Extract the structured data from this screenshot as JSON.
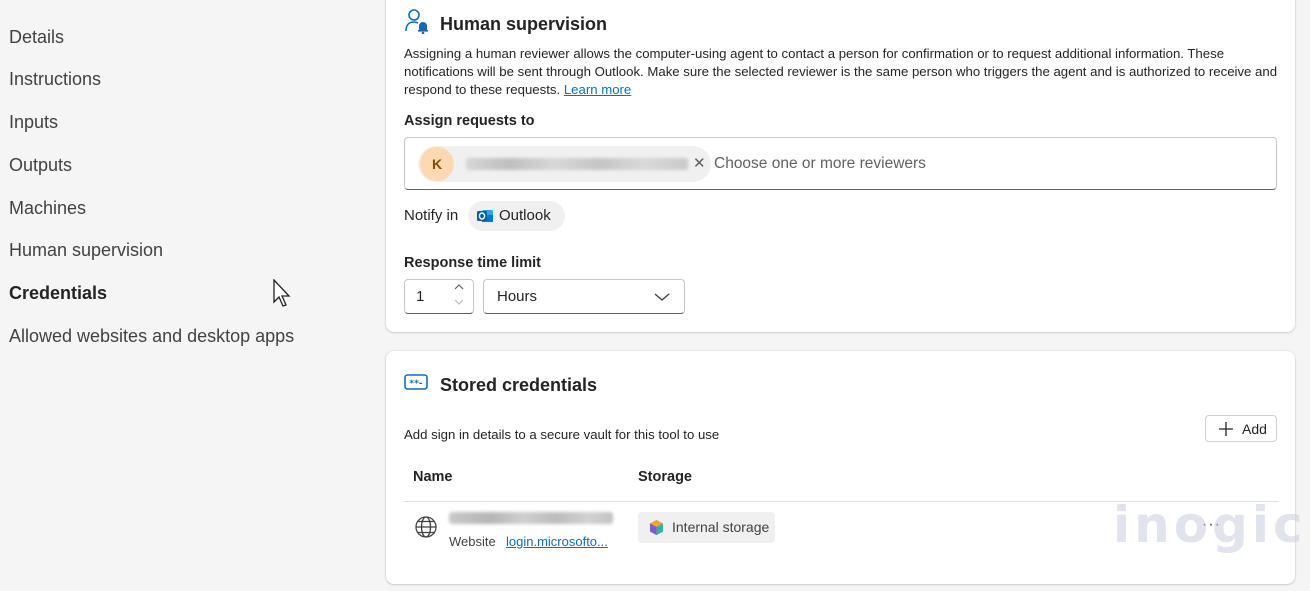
{
  "sidebar": {
    "items": [
      {
        "label": "Details"
      },
      {
        "label": "Instructions"
      },
      {
        "label": "Inputs"
      },
      {
        "label": "Outputs"
      },
      {
        "label": "Machines"
      },
      {
        "label": "Human supervision"
      },
      {
        "label": "Credentials",
        "active": true
      },
      {
        "label": "Allowed websites and desktop apps"
      }
    ]
  },
  "human_supervision": {
    "title": "Human supervision",
    "icon": "person-bell-icon",
    "description": "Assigning a human reviewer allows the computer-using agent to contact a person for confirmation or to request additional information. These notifications will be sent through Outlook. Make sure the selected reviewer is the same person who triggers the agent and is authorized to receive and respond to these requests.",
    "learn_more": "Learn more",
    "assign_label": "Assign requests to",
    "reviewer": {
      "initial": "K"
    },
    "picker_placeholder": "Choose one or more reviewers",
    "notify_label": "Notify in",
    "notify_channel": "Outlook",
    "response_label": "Response time limit",
    "response_value": "1",
    "response_unit": "Hours"
  },
  "stored_credentials": {
    "title": "Stored credentials",
    "icon": "password-icon",
    "description": "Add sign in details to a secure vault for this tool to use",
    "add_label": "Add",
    "columns": [
      "Name",
      "Storage"
    ],
    "rows": [
      {
        "type": "Website",
        "url": "login.microsofto...",
        "storage": "Internal storage"
      }
    ]
  },
  "watermark": "inogic",
  "colors": {
    "accent": "#0f6cbd",
    "avatar_bg": "#fcd9b0",
    "chip_bg": "#f0f0f0"
  }
}
